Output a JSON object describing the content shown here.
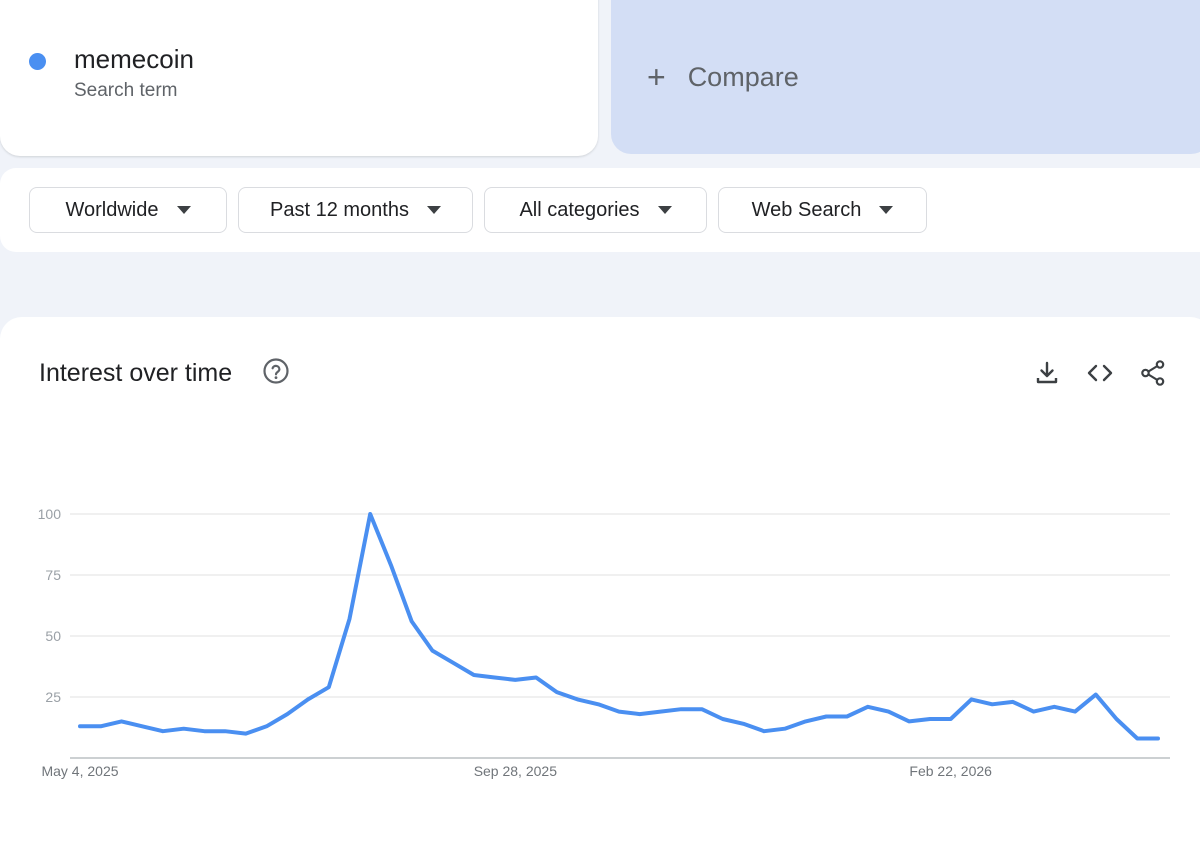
{
  "search_term": {
    "name": "memecoin",
    "subtitle": "Search term",
    "color": "#4a8ff1"
  },
  "compare": {
    "icon": "plus-icon",
    "label": "Compare"
  },
  "filters": [
    {
      "label": "Worldwide"
    },
    {
      "label": "Past 12 months"
    },
    {
      "label": "All categories"
    },
    {
      "label": "Web Search"
    }
  ],
  "panel": {
    "title": "Interest over time",
    "help_icon": "help-circle-icon",
    "actions": [
      "download-icon",
      "embed-code-icon",
      "share-icon"
    ]
  },
  "chart_data": {
    "type": "line",
    "yticks": [
      25,
      50,
      75,
      100
    ],
    "ylim": [
      0,
      100
    ],
    "x_labels": [
      {
        "text": "May 4, 2025",
        "index": 0
      },
      {
        "text": "Sep 28, 2025",
        "index": 21
      },
      {
        "text": "Feb 22, 2026",
        "index": 42
      }
    ],
    "grid": true,
    "series": [
      {
        "color": "#4a8ff1",
        "values": [
          13,
          13,
          15,
          13,
          11,
          12,
          11,
          11,
          10,
          13,
          18,
          24,
          29,
          57,
          100,
          79,
          56,
          44,
          39,
          34,
          33,
          32,
          33,
          27,
          24,
          22,
          19,
          18,
          19,
          20,
          20,
          16,
          14,
          11,
          12,
          15,
          17,
          17,
          21,
          19,
          15,
          16,
          16,
          24,
          22,
          23,
          19,
          21,
          19,
          26,
          16,
          8,
          8
        ]
      }
    ]
  }
}
